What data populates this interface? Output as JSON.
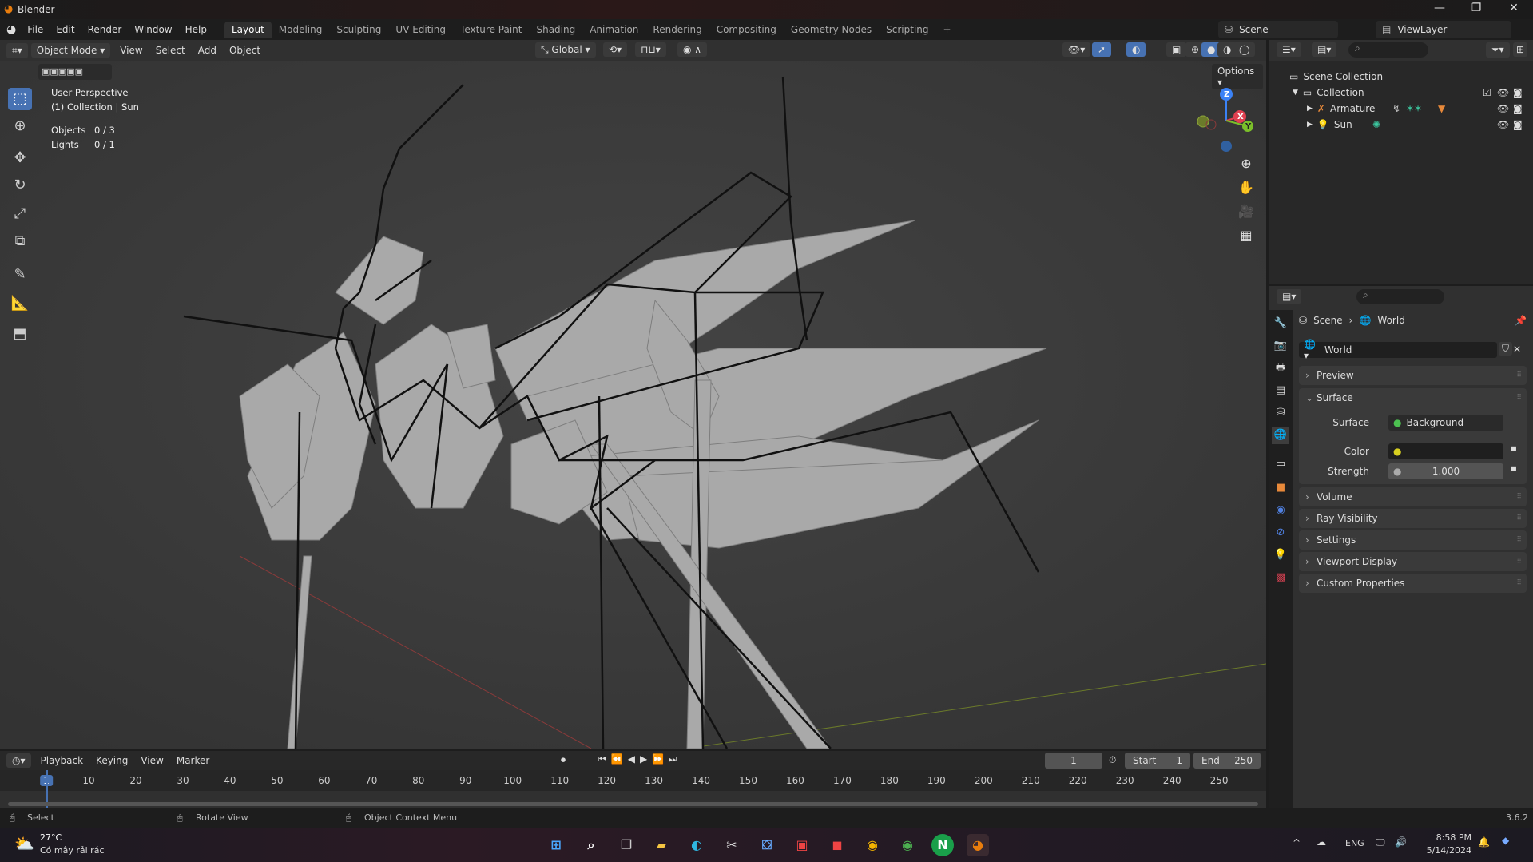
{
  "window": {
    "title": "Blender",
    "minimize": "—",
    "maximize": "❐",
    "close": "✕"
  },
  "menu": {
    "items": [
      "File",
      "Edit",
      "Render",
      "Window",
      "Help"
    ]
  },
  "workspaces": [
    "Layout",
    "Modeling",
    "Sculpting",
    "UV Editing",
    "Texture Paint",
    "Shading",
    "Animation",
    "Rendering",
    "Compositing",
    "Geometry Nodes",
    "Scripting",
    "+"
  ],
  "scene": {
    "name": "Scene",
    "view_layer": "ViewLayer"
  },
  "viewport_header": {
    "mode": "Object Mode",
    "menus": [
      "View",
      "Select",
      "Add",
      "Object"
    ],
    "orientation": "Global",
    "options": "Options"
  },
  "overlay": {
    "perspective": "User Perspective",
    "collection": "(1) Collection | Sun",
    "objects_label": "Objects",
    "objects_value": "0 / 3",
    "lights_label": "Lights",
    "lights_value": "0 / 1"
  },
  "gizmo": {
    "z": "Z",
    "x": "X",
    "y": "Y"
  },
  "outliner": {
    "root": "Scene Collection",
    "collection": "Collection",
    "items": [
      "Armature",
      "Sun"
    ]
  },
  "properties": {
    "breadcrumb": [
      "Scene",
      "World"
    ],
    "world_name": "World",
    "panels": {
      "preview": "Preview",
      "surface": "Surface",
      "volume": "Volume",
      "ray": "Ray Visibility",
      "settings": "Settings",
      "viewport": "Viewport Display",
      "custom": "Custom Properties"
    },
    "surface_label": "Surface",
    "surface_value": "Background",
    "color_label": "Color",
    "strength_label": "Strength",
    "strength_value": "1.000"
  },
  "timeline": {
    "menus": [
      "Playback",
      "Keying",
      "View",
      "Marker"
    ],
    "current_frame": "1",
    "start_label": "Start",
    "start": "1",
    "end_label": "End",
    "end": "250",
    "ticks": [
      "1",
      "10",
      "20",
      "30",
      "40",
      "50",
      "60",
      "70",
      "80",
      "90",
      "100",
      "110",
      "120",
      "130",
      "140",
      "150",
      "160",
      "170",
      "180",
      "190",
      "200",
      "210",
      "220",
      "230",
      "240",
      "250"
    ]
  },
  "status": {
    "select": "Select",
    "rotate": "Rotate View",
    "context": "Object Context Menu",
    "version": "3.6.2"
  },
  "taskbar": {
    "temp": "27°C",
    "weather": "Có mây rải rác",
    "lang": "ENG",
    "time": "8:58 PM",
    "date": "5/14/2024"
  }
}
